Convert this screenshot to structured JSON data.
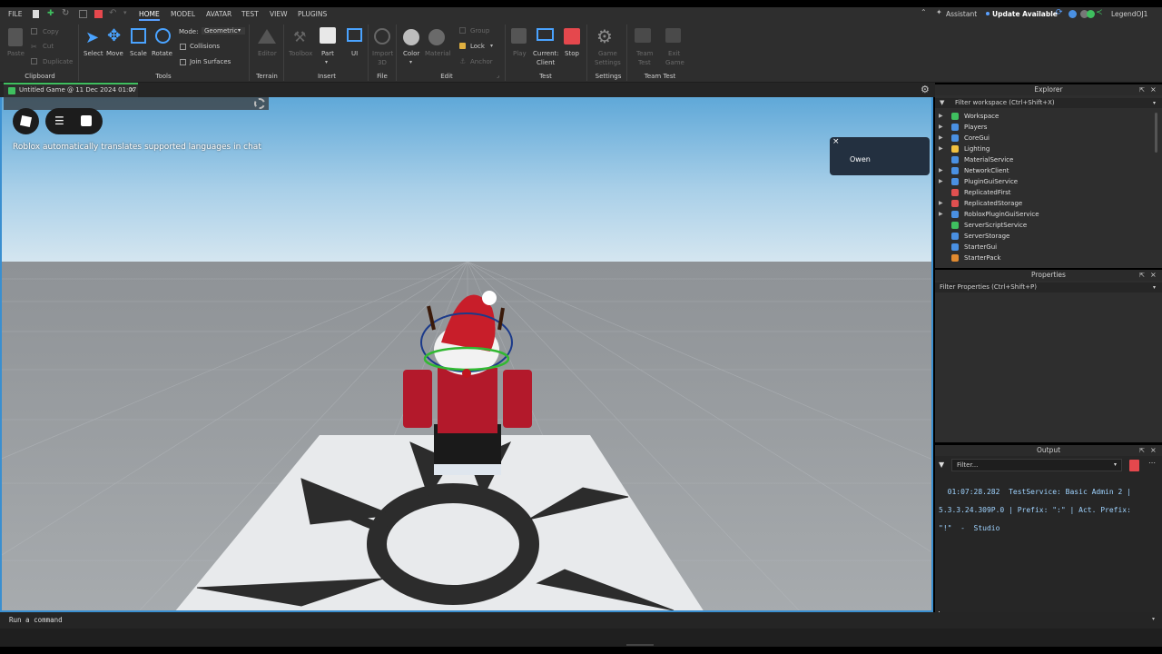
{
  "menubar": {
    "file": "FILE",
    "tabs": [
      {
        "label": "HOME",
        "active": true
      },
      {
        "label": "MODEL"
      },
      {
        "label": "AVATAR"
      },
      {
        "label": "TEST"
      },
      {
        "label": "VIEW"
      },
      {
        "label": "PLUGINS"
      }
    ],
    "assistant": "Assistant",
    "update": "Update Available",
    "user": "LegendOJ1"
  },
  "ribbon": {
    "clipboard": {
      "paste": "Paste",
      "copy": "Copy",
      "cut": "Cut",
      "duplicate": "Duplicate",
      "title": "Clipboard"
    },
    "tools": {
      "select": "Select",
      "move": "Move",
      "scale": "Scale",
      "rotate": "Rotate",
      "mode_label": "Mode:",
      "mode_value": "Geometric",
      "collisions": "Collisions",
      "join_surfaces": "Join Surfaces",
      "title": "Tools"
    },
    "terrain": {
      "editor": "Editor",
      "title": "Terrain"
    },
    "insert": {
      "toolbox": "Toolbox",
      "part": "Part",
      "ui": "UI",
      "title": "Insert"
    },
    "file": {
      "import_line1": "Import",
      "import_line2": "3D",
      "title": "File"
    },
    "edit": {
      "color": "Color",
      "material": "Material",
      "group": "Group",
      "lock": "Lock",
      "anchor": "Anchor",
      "title": "Edit"
    },
    "test": {
      "play": "Play",
      "current_line1": "Current:",
      "current_line2": "Client",
      "stop": "Stop",
      "title": "Test"
    },
    "settings": {
      "game_line1": "Game",
      "game_line2": "Settings",
      "title": "Settings"
    },
    "team_test": {
      "team_line1": "Team",
      "team_line2": "Test",
      "exit_line1": "Exit",
      "exit_line2": "Game",
      "title": "Team Test"
    }
  },
  "doc_tab": {
    "title": "Untitled Game @ 11 Dec 2024 01:07"
  },
  "viewport": {
    "translate_notice": "Roblox automatically translates supported languages in chat",
    "player_popup": "Owen"
  },
  "explorer": {
    "title": "Explorer",
    "filter_placeholder": "Filter workspace (Ctrl+Shift+X)",
    "items": [
      {
        "label": "Workspace",
        "expandable": true,
        "color": "#3fbf5f"
      },
      {
        "label": "Players",
        "expandable": true,
        "color": "#4a90e2"
      },
      {
        "label": "CoreGui",
        "expandable": true,
        "color": "#4a90e2"
      },
      {
        "label": "Lighting",
        "expandable": true,
        "color": "#f0c040"
      },
      {
        "label": "MaterialService",
        "expandable": false,
        "color": "#4a90e2"
      },
      {
        "label": "NetworkClient",
        "expandable": true,
        "color": "#4a90e2"
      },
      {
        "label": "PluginGuiService",
        "expandable": true,
        "color": "#4a90e2"
      },
      {
        "label": "ReplicatedFirst",
        "expandable": false,
        "color": "#e05050"
      },
      {
        "label": "ReplicatedStorage",
        "expandable": true,
        "color": "#e05050"
      },
      {
        "label": "RobloxPluginGuiService",
        "expandable": true,
        "color": "#4a90e2"
      },
      {
        "label": "ServerScriptService",
        "expandable": false,
        "color": "#3fbf5f"
      },
      {
        "label": "ServerStorage",
        "expandable": false,
        "color": "#4a90e2"
      },
      {
        "label": "StarterGui",
        "expandable": false,
        "color": "#4a90e2"
      },
      {
        "label": "StarterPack",
        "expandable": false,
        "color": "#e08a30"
      }
    ]
  },
  "properties": {
    "title": "Properties",
    "filter_placeholder": "Filter Properties (Ctrl+Shift+P)"
  },
  "output": {
    "title": "Output",
    "filter_placeholder": "Filter...",
    "lines": [
      "  01:07:28.282  TestService: Basic Admin 2 |",
      "5.3.3.24.309P.0 | Prefix: \":\" | Act. Prefix:",
      "\"!\"  -  Studio"
    ]
  },
  "command_bar": {
    "placeholder": "Run a command"
  },
  "colors": {
    "accent": "#3a8fd0",
    "stop": "#e5484d",
    "background": "#2e2e2e"
  }
}
